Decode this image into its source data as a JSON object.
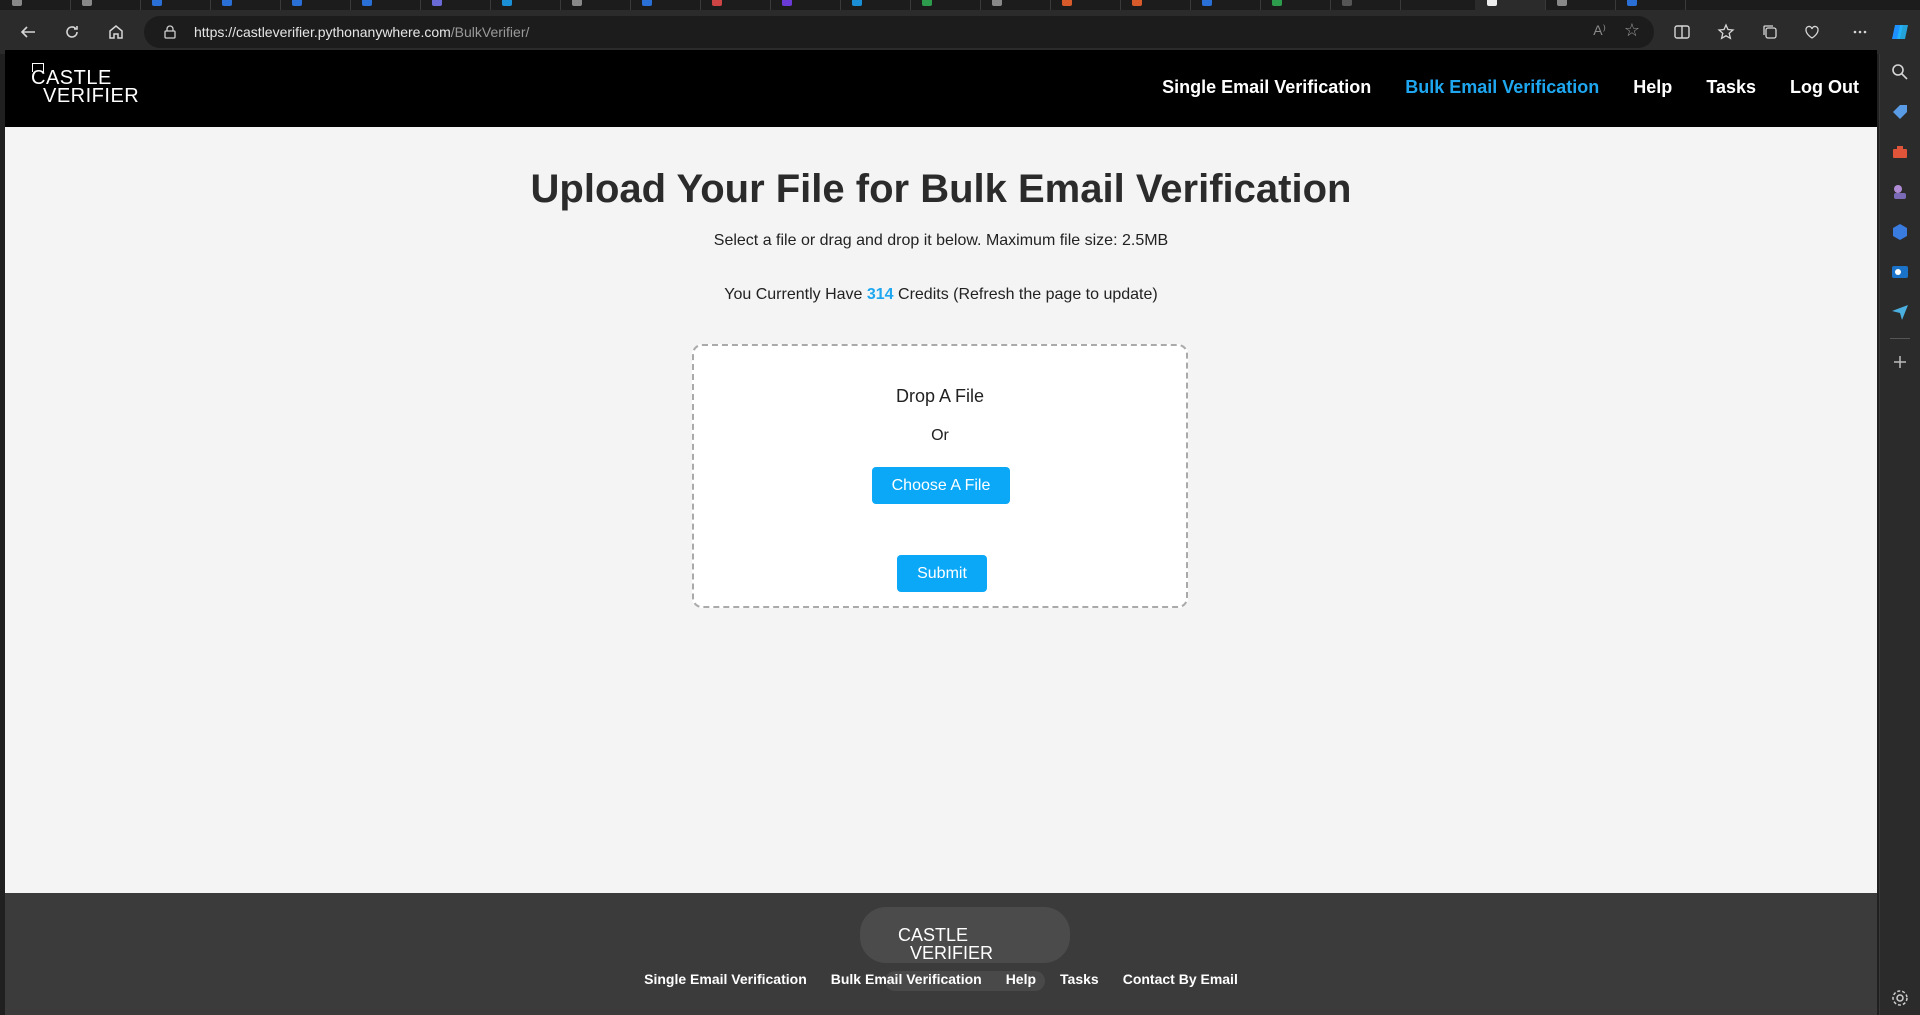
{
  "browser": {
    "url_host": "https://castleverifier.pythonanywhere.com",
    "url_path": "/BulkVerifier/",
    "read_aloud": "A⁾"
  },
  "brand": {
    "line1": "CASTLE",
    "line2": "VERIFIER"
  },
  "nav": {
    "items": [
      {
        "label": "Single Email Verification",
        "active": false
      },
      {
        "label": "Bulk Email Verification",
        "active": true
      },
      {
        "label": "Help",
        "active": false
      },
      {
        "label": "Tasks",
        "active": false
      },
      {
        "label": "Log Out",
        "active": false
      }
    ]
  },
  "main": {
    "title": "Upload Your File for Bulk Email Verification",
    "subtitle": "Select a file or drag and drop it below. Maximum file size: 2.5MB",
    "credits_prefix": "You Currently Have ",
    "credits_value": "314",
    "credits_suffix": " Credits (Refresh the page to update)",
    "dropzone": {
      "title": "Drop A File",
      "or": "Or",
      "choose_label": "Choose A File",
      "submit_label": "Submit"
    }
  },
  "footer": {
    "links": [
      "Single Email Verification",
      "Bulk Email Verification",
      "Help",
      "Tasks",
      "Contact By Email"
    ]
  },
  "colors": {
    "accent": "#1ea7f0",
    "button": "#0aa8f7",
    "nav_bg": "#000000",
    "footer_bg": "#3b3b3b",
    "page_bg": "#f4f4f4"
  }
}
